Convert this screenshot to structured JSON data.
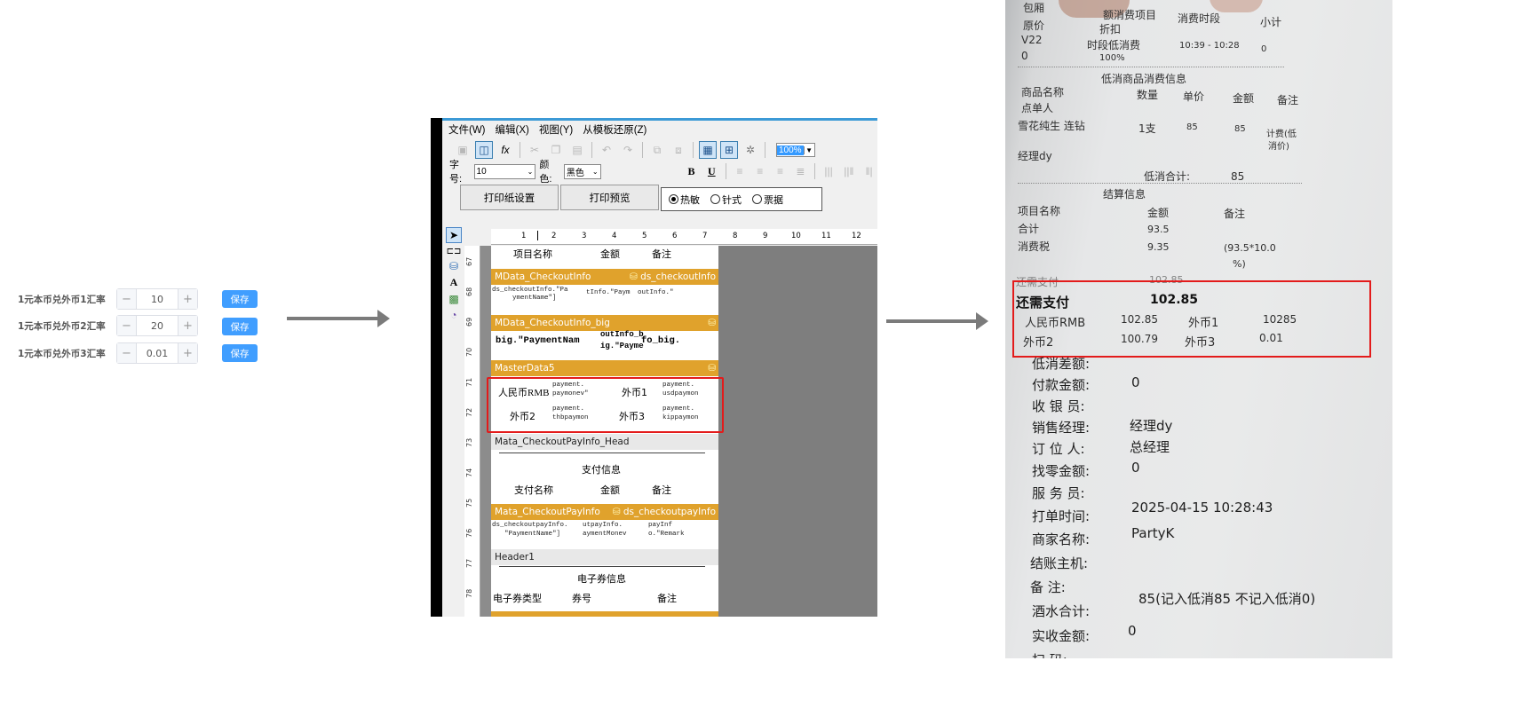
{
  "rates": [
    {
      "label": "1元本币兑外币1汇率",
      "value": "10",
      "minus": "−",
      "plus": "+",
      "save": "保存"
    },
    {
      "label": "1元本币兑外币2汇率",
      "value": "20",
      "minus": "−",
      "plus": "+",
      "save": "保存"
    },
    {
      "label": "1元本币兑外币3汇率",
      "value": "0.01",
      "minus": "−",
      "plus": "+",
      "save": "保存"
    }
  ],
  "designer": {
    "menu": [
      "文件(W)",
      "编辑(X)",
      "视图(Y)",
      "从模板还原(Z)"
    ],
    "zoom": "100%",
    "font_size_label": "字号:",
    "font_size_value": "10",
    "color_label": "颜色:",
    "color_value": "黑色",
    "bold": "B",
    "underline": "U",
    "fx": "fx",
    "print_setup_button": "打印纸设置",
    "print_preview_button": "打印预览",
    "print_modes": [
      "热敏",
      "针式",
      "票据"
    ],
    "ruler": [
      "1",
      "2",
      "3",
      "4",
      "5",
      "6",
      "7",
      "8",
      "9",
      "10",
      "11",
      "12"
    ],
    "row_numbers": [
      "67",
      "68",
      "69",
      "70",
      "71",
      "72",
      "73",
      "74",
      "75",
      "76",
      "77",
      "78"
    ],
    "bands": {
      "checkout_info": {
        "name": "MData_CheckoutInfo",
        "source": "ds_checkoutInfo"
      },
      "checkout_info_big": {
        "name": "MData_CheckoutInfo_big"
      },
      "master5": {
        "name": "MasterData5"
      },
      "pay_head": {
        "name": "Mata_CheckoutPayInfo_Head"
      },
      "pay_info": {
        "name": "Mata_CheckoutPayInfo",
        "source": "ds_checkoutpayInfo"
      },
      "header1": {
        "name": "Header1"
      }
    },
    "top_headers": [
      "项目名称",
      "金额",
      "备注"
    ],
    "checkout_fields": [
      "ds_checkoutInfo.\"Pa",
      "ymentName\"]",
      "tInfo.\"Paym",
      "outInfo.\""
    ],
    "big_fields": [
      "big.\"PaymentNam",
      "outInfo_b",
      "ig.\"Payme",
      "fo_big."
    ],
    "currency": {
      "rmb": "人民币RMB",
      "f1": "外币1",
      "f2": "外币2",
      "f3": "外币3",
      "v_rmb": [
        "payment.",
        "paymonev\""
      ],
      "v_f1": [
        "payment.",
        "usdpaymon"
      ],
      "v_f2": [
        "payment.",
        "thbpaymon"
      ],
      "v_f3": [
        "payment.",
        "kippaymon"
      ]
    },
    "pay_head_title": "支付信息",
    "pay_head_cols": [
      "支付名称",
      "金额",
      "备注"
    ],
    "pay_fields": [
      "ds_checkoutpayInfo.",
      "\"PaymentName\"]",
      "utpayInfo.",
      "aymentMonev",
      "payInf",
      "o.\"Remark"
    ],
    "header1_title": "电子券信息",
    "header1_cols": [
      "电子券类型",
      "券号",
      "备注"
    ]
  },
  "receipt": {
    "top_lines": [
      [
        "包厢",
        "额消费项目",
        "消费时段",
        "小计"
      ],
      [
        "原价",
        "折扣",
        "",
        ""
      ],
      [
        "V22",
        "时段低消费",
        "10:39 - 10:28",
        "0"
      ],
      [
        "0",
        "100%",
        "",
        ""
      ]
    ],
    "low_title": "低消商品消费信息",
    "low_header": [
      "商品名称",
      "数量",
      "单价",
      "金额",
      "备注"
    ],
    "low_sub": "点单人",
    "low_row": [
      "雪花纯生 连钻",
      "1支",
      "85",
      "85",
      "计费(低",
      "消价)"
    ],
    "manager": "经理dy",
    "low_total_label": "低消合计:",
    "low_total": "85",
    "settle_title": "结算信息",
    "settle_header": [
      "项目名称",
      "金额",
      "备注"
    ],
    "settle_rows": [
      [
        "合计",
        "93.5",
        ""
      ],
      [
        "消费税",
        "9.35",
        "(93.5*10.0"
      ],
      [
        "",
        "",
        "%)"
      ]
    ],
    "due_small": [
      "还需支付",
      "102.85"
    ],
    "due_label": "还需支付",
    "due_value": "102.85",
    "cur_line1": [
      "人民币RMB",
      "102.85",
      "外币1",
      "10285"
    ],
    "cur_line2": [
      "外币2",
      "100.79",
      "外币3",
      "0.01"
    ],
    "details": [
      [
        "低消差额:",
        ""
      ],
      [
        "付款金额:",
        "0"
      ],
      [
        "收 银 员:",
        ""
      ],
      [
        "销售经理:",
        "经理dy"
      ],
      [
        "订 位 人:",
        "总经理"
      ],
      [
        "找零金额:",
        "0"
      ],
      [
        "服 务 员:",
        ""
      ],
      [
        "打单时间:",
        "2025-04-15 10:28:43"
      ],
      [
        "商家名称:",
        "PartyK"
      ],
      [
        "结账主机:",
        ""
      ],
      [
        "备    注:",
        ""
      ],
      [
        "酒水合计:",
        "85(记入低消85 不记入低消0)"
      ],
      [
        "实收金额:",
        "0"
      ],
      [
        "扫    码:",
        ""
      ]
    ]
  }
}
